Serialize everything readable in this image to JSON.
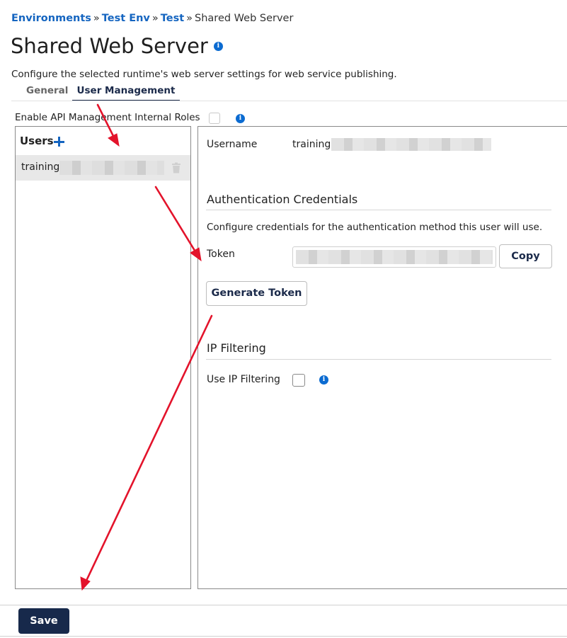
{
  "breadcrumb": {
    "items": [
      "Environments",
      "Test Env",
      "Test"
    ],
    "separator": "»",
    "current": "Shared Web Server"
  },
  "page": {
    "title": "Shared Web Server",
    "info_icon": "info-icon",
    "subtitle": "Configure the selected runtime's web server settings for web service publishing."
  },
  "tabs": [
    {
      "label": "General",
      "active": false
    },
    {
      "label": "User Management",
      "active": true
    }
  ],
  "roles": {
    "label": "Enable API Management Internal Roles",
    "checked": false
  },
  "users": {
    "header": "Users",
    "add_icon": "plus-icon",
    "items": [
      {
        "name": "training",
        "selected": true,
        "delete_icon": "trash-icon"
      }
    ]
  },
  "details": {
    "username_label": "Username",
    "username_value": "training",
    "auth": {
      "title": "Authentication Credentials",
      "description": "Configure credentials for the authentication method this user will use.",
      "token_label": "Token",
      "token_value": "",
      "copy_label": "Copy",
      "generate_label": "Generate Token"
    },
    "ip": {
      "title": "IP Filtering",
      "use_label": "Use IP Filtering",
      "checked": false
    }
  },
  "footer": {
    "save_label": "Save"
  },
  "colors": {
    "link": "#1565c0",
    "primary_button": "#17294b",
    "info_icon": "#0b6bd1",
    "annotation_arrow": "#e3132b"
  }
}
